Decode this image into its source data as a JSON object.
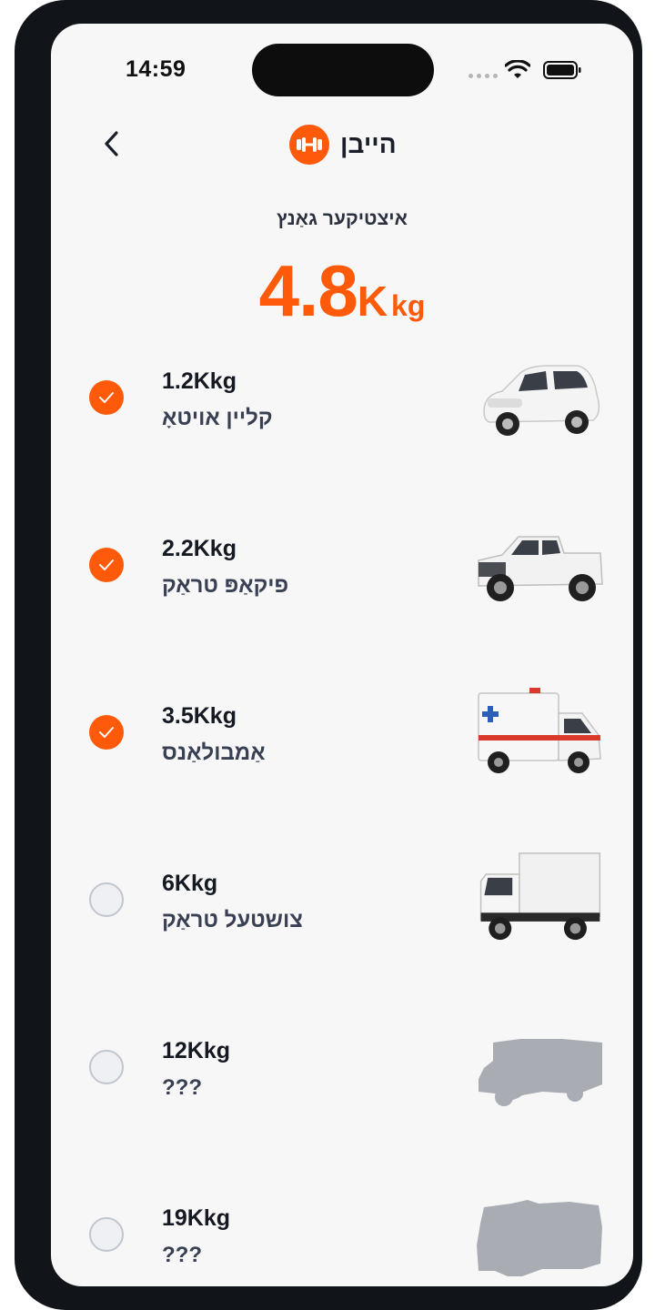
{
  "status_bar": {
    "time": "14:59"
  },
  "header": {
    "brand_name": "הייבן",
    "logo_icon": "dumbbell-icon",
    "back_icon": "chevron-left-icon"
  },
  "summary": {
    "label": "איצטיקער גאַנץ",
    "value": "4.8",
    "value_suffix": "K",
    "unit": "kg"
  },
  "accent_color": "#ff5a0a",
  "items": [
    {
      "weight": "1.2Kkg",
      "name": "קליין אויטאָ",
      "checked": true,
      "icon": "small-car-icon"
    },
    {
      "weight": "2.2Kkg",
      "name": "פיקאַפּ טראַק",
      "checked": true,
      "icon": "pickup-truck-icon"
    },
    {
      "weight": "3.5Kkg",
      "name": "אַמבולאַנס",
      "checked": true,
      "icon": "ambulance-icon"
    },
    {
      "weight": "6Kkg",
      "name": "צושטעל טראַק",
      "checked": false,
      "icon": "box-truck-icon"
    },
    {
      "weight": "12Kkg",
      "name": "???",
      "checked": false,
      "icon": "locked-truck-silhouette-icon"
    },
    {
      "weight": "19Kkg",
      "name": "???",
      "checked": false,
      "icon": "locked-heavy-truck-silhouette-icon"
    }
  ]
}
